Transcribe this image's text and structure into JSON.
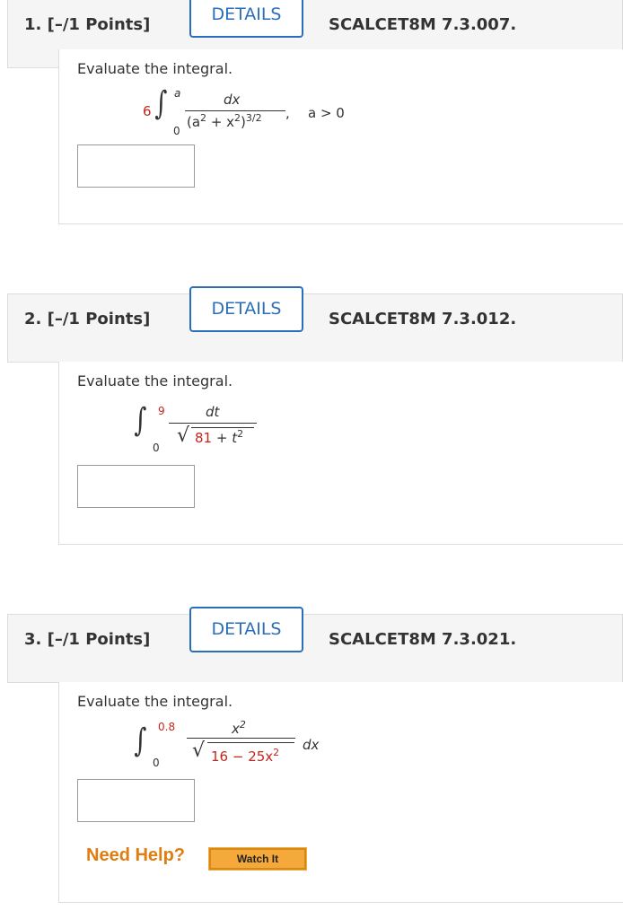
{
  "questions": [
    {
      "points": "1. [–/1 Points]",
      "details": "DETAILS",
      "ref": "SCALCET8M 7.3.007.",
      "prompt": "Evaluate the integral.",
      "coef": "6",
      "upper": "a",
      "lower": "0",
      "numerator": "dx",
      "denominator": "(a",
      "den_sup1": "2",
      "den_mid": " + x",
      "den_sup2": "2",
      "den_close": ")",
      "den_sup3": "3/2",
      "trail": ",",
      "condition": "a > 0"
    },
    {
      "points": "2. [–/1 Points]",
      "details": "DETAILS",
      "ref": "SCALCET8M 7.3.012.",
      "prompt": "Evaluate the integral.",
      "upper": "9",
      "lower": "0",
      "numerator": "dt",
      "rad_num": "81",
      "rad_mid": " + t",
      "rad_sup": "2"
    },
    {
      "points": "3. [–/1 Points]",
      "details": "DETAILS",
      "ref": "SCALCET8M 7.3.021.",
      "prompt": "Evaluate the integral.",
      "upper": "0.8",
      "lower": "0",
      "numerator": "x",
      "num_sup": "2",
      "rad_num": "16",
      "rad_mid": " − 25x",
      "rad_sup": "2",
      "trail": "dx",
      "need_help": "Need Help?",
      "watch": "Watch It"
    }
  ],
  "colors": {
    "accent": "#2a6ebb",
    "given": "#c4261d",
    "help": "#e07d10",
    "watch_bg": "#f4a93a"
  }
}
